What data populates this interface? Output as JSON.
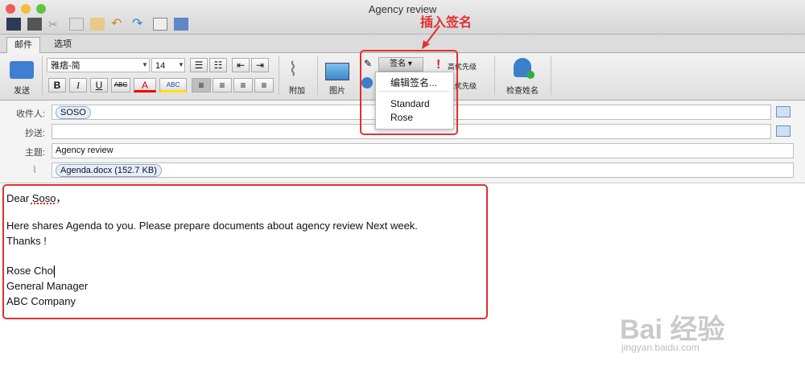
{
  "window": {
    "title": "Agency review"
  },
  "tabs": [
    {
      "label": "邮件"
    },
    {
      "label": "选项"
    }
  ],
  "ribbon": {
    "send_label": "发送",
    "font_name": "雅痞-简",
    "font_size": "14",
    "bold": "B",
    "italic": "I",
    "underline": "U",
    "strike": "ABC",
    "font_color": "A",
    "highlight": "ABC",
    "attach_label": "附加",
    "picture_label": "图片",
    "signature_label": "签名",
    "high_priority": "高优先级",
    "low_priority": "低优先级",
    "check_names": "检查姓名"
  },
  "signature_menu": {
    "items": [
      "编辑签名...",
      "Standard",
      "Rose"
    ]
  },
  "annotation": {
    "text": "插入签名",
    "color": "#e03030"
  },
  "header": {
    "to_label": "收件人:",
    "to_value": "SOSO",
    "cc_label": "抄送:",
    "subject_label": "主题:",
    "subject_value": "Agency review",
    "attachment": "Agenda.docx (152.7 KB)"
  },
  "body": {
    "lines": [
      "Dear Soso，",
      "Here shares Agenda to you. Please  prepare documents about agency review Next week.",
      "Thanks !",
      "Rose Choi",
      "General Manager",
      "ABC Company"
    ]
  },
  "watermark": {
    "brand": "Bai 经验",
    "url": "jingyan.baidu.com"
  }
}
